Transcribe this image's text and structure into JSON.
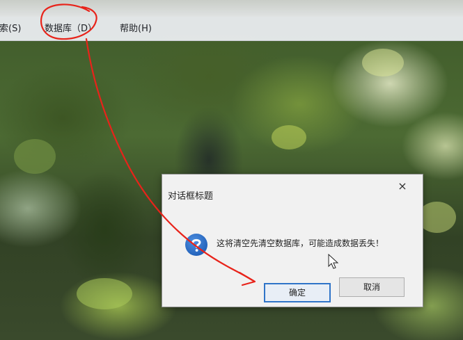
{
  "menubar": {
    "items": [
      {
        "label": "搜索(S)"
      },
      {
        "label": "数据库（D）"
      },
      {
        "label": "帮助(H)"
      }
    ]
  },
  "dialog": {
    "title": "对话框标题",
    "close_glyph": "×",
    "icon": "question-icon",
    "message": "这将清空先清空数据库，可能造成数据丢失！",
    "ok_label": "确定",
    "cancel_label": "取消"
  },
  "colors": {
    "accent": "#2f74c8",
    "annotation": "#e8231a",
    "question_icon": "#1f5fb8"
  }
}
